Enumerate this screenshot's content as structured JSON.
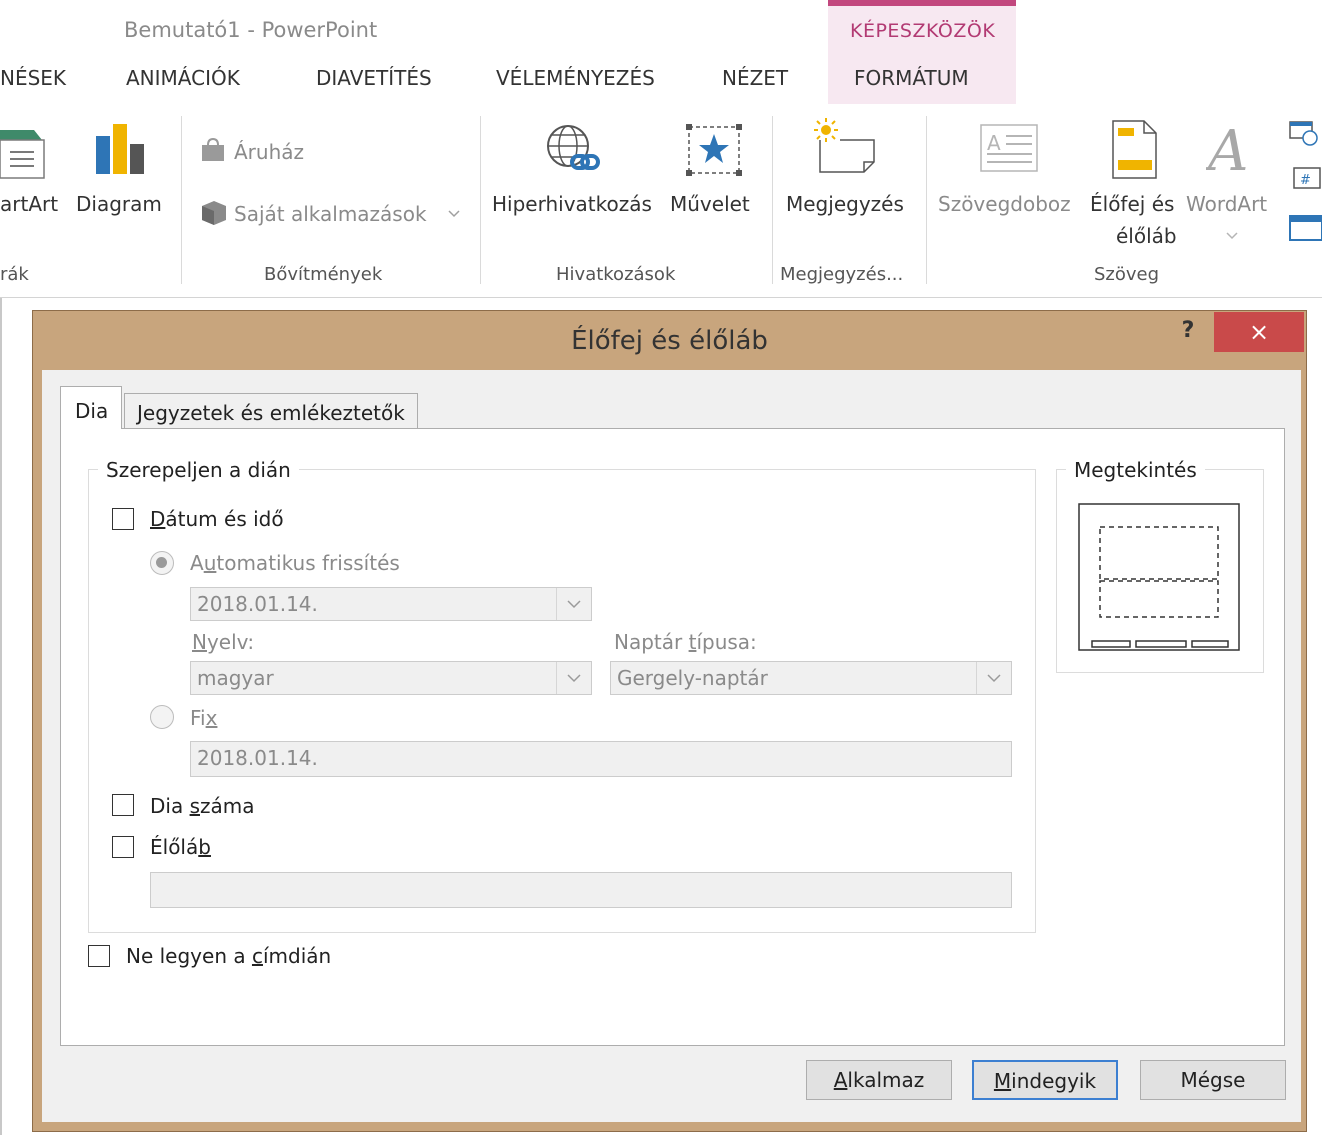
{
  "app": {
    "title": "Bemutató1 - PowerPoint"
  },
  "context_tab": {
    "title": "KÉPESZKÖZÖK"
  },
  "tabs": [
    "NÉSEK",
    "ANIMÁCIÓK",
    "DIAVETÍTÉS",
    "VÉLEMÉNYEZÉS",
    "NÉZET",
    "FORMÁTUM"
  ],
  "ribbon": {
    "smartart": "artArt",
    "diagram": "Diagram",
    "store": "Áruház",
    "my_apps": "Saját alkalmazások",
    "hyperlink": "Hiperhivatkozás",
    "action": "Művelet",
    "comment": "Megjegyzés",
    "textbox": "Szövegdoboz",
    "header_footer_1": "Élőfej és",
    "header_footer_2": "élőláb",
    "wordart": "WordArt",
    "groups": {
      "illustrations": "rák",
      "addins": "Bővítmények",
      "links": "Hivatkozások",
      "comments": "Megjegyzés...",
      "text": "Szöveg"
    }
  },
  "dialog": {
    "title": "Élőfej és élőláb",
    "help": "?",
    "close": "×",
    "tabs": {
      "slide": "Dia",
      "notes": "Jegyzetek és emlékeztetők"
    },
    "include_group": "Szerepeljen a dián",
    "date_time": {
      "prefix": "",
      "accel": "D",
      "rest": "átum és idő",
      "checked": false
    },
    "auto_update": {
      "prefix": "A",
      "accel": "u",
      "rest": "tomatikus frissítés",
      "selected": true
    },
    "auto_date_value": "2018.01.14.",
    "language": {
      "accel": "N",
      "rest": "yelv:",
      "value": "magyar"
    },
    "calendar": {
      "prefix": "Naptár ",
      "accel": "t",
      "rest": "ípusa:",
      "value": "Gergely-naptár"
    },
    "fixed": {
      "prefix": "Fi",
      "accel": "x",
      "rest": "",
      "selected": false
    },
    "fixed_value": "2018.01.14.",
    "slide_number": {
      "prefix": "Dia ",
      "accel": "s",
      "rest": "záma",
      "checked": false
    },
    "footer": {
      "prefix": "Élőlá",
      "accel": "b",
      "rest": "",
      "checked": false
    },
    "footer_value": "",
    "dont_show_title": {
      "prefix": "Ne legyen a ",
      "accel": "c",
      "rest": "ímdián",
      "checked": false
    },
    "preview": "Megtekintés",
    "buttons": {
      "apply": {
        "accel": "A",
        "rest": "lkalmaz"
      },
      "apply_all": {
        "accel": "M",
        "rest": "indegyik"
      },
      "cancel": "Mégse"
    }
  },
  "colors": {
    "context_accent": "#c2477e",
    "dialog_border": "#c8a57d",
    "close_red": "#c94a4a",
    "default_button": "#3c7fd1"
  }
}
